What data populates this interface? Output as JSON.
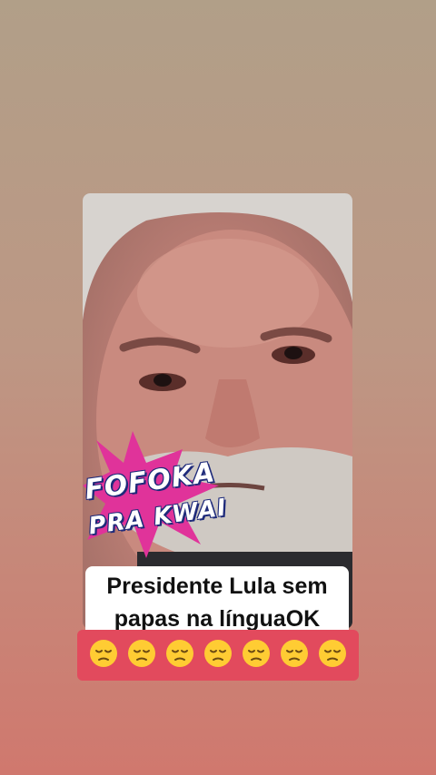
{
  "post": {
    "caption_text": "Presidente Lula sem papas na línguaOK",
    "badge_line1": "FOFOKA",
    "badge_line2": "PRA KWAI"
  },
  "reaction_bar": {
    "emoji_name": "pensive-face",
    "count": 7
  },
  "colors": {
    "background_top": "#b19f88",
    "background_bottom": "#d0786e",
    "reaction_bar": "#e24a5d",
    "badge_burst": "#e0339a",
    "badge_text_outline": "#1e2a7a"
  }
}
